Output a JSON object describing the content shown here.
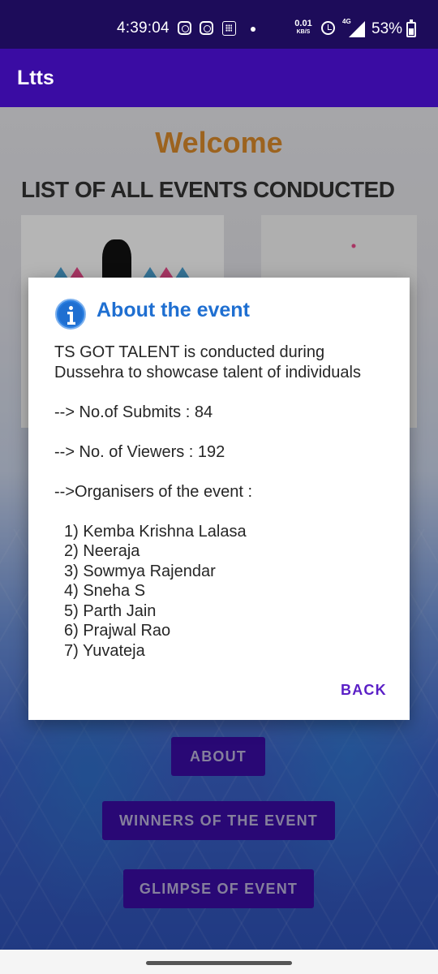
{
  "status_bar": {
    "time": "4:39:04",
    "net_speed_value": "0.01",
    "net_speed_unit": "KB/S",
    "network_type": "4G",
    "battery": "53%"
  },
  "app_bar": {
    "title": "Ltts"
  },
  "main": {
    "welcome": "Welcome",
    "list_title": "LIST OF ALL EVENTS CONDUCTED",
    "buttons": {
      "about": "ABOUT",
      "winners": "WINNERS OF THE EVENT",
      "glimpse": "GLIMPSE OF EVENT"
    }
  },
  "dialog": {
    "title": "About the event",
    "description": "TS GOT TALENT is conducted during Dussehra to showcase talent of individuals",
    "submits": "--> No.of Submits : 84",
    "viewers": "--> No. of Viewers : 192",
    "organisers_heading": "-->Organisers of the event :",
    "organisers": [
      "1) Kemba Krishna Lalasa",
      "2) Neeraja",
      "3) Sowmya Rajendar",
      "4) Sneha S",
      "5) Parth Jain",
      "6) Prajwal Rao",
      "7) Yuvateja"
    ],
    "back_label": "BACK"
  },
  "colors": {
    "status_bar": "#1d0c5a",
    "app_bar": "#3a0ca3",
    "dialog_title": "#1f6fd1",
    "back_button": "#5a1fc6",
    "welcome": "#d98a2b"
  },
  "icons": [
    "instagram-icon",
    "instagram-icon",
    "calculator-icon",
    "alarm-icon",
    "signal-icon",
    "battery-icon",
    "info-icon"
  ]
}
